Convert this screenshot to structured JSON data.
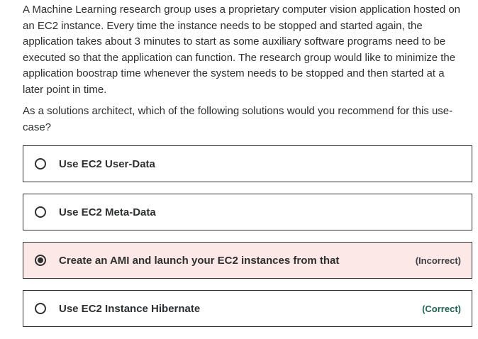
{
  "question": {
    "paragraph1": "A Machine Learning research group uses a proprietary computer vision application hosted on an EC2 instance. Every time the instance needs to be stopped and started again, the application takes about 3 minutes to start as some auxiliary software programs need to be executed so that the application can function. The research group would like to minimize the application boostrap time whenever the system needs to be stopped and then started at a later point in time.",
    "paragraph2": "As a solutions architect, which of the following solutions would you recommend for this use-case?"
  },
  "options": [
    {
      "label": "Use EC2 User-Data",
      "selected": false,
      "verdict": ""
    },
    {
      "label": "Use EC2 Meta-Data",
      "selected": false,
      "verdict": ""
    },
    {
      "label": "Create an AMI and launch your EC2 instances from that",
      "selected": true,
      "verdict": "(Incorrect)"
    },
    {
      "label": "Use EC2 Instance Hibernate",
      "selected": false,
      "verdict": "(Correct)"
    }
  ],
  "colors": {
    "incorrect_bg": "#fce8e6",
    "correct_text": "#1e6055",
    "border": "#2d2f31"
  }
}
